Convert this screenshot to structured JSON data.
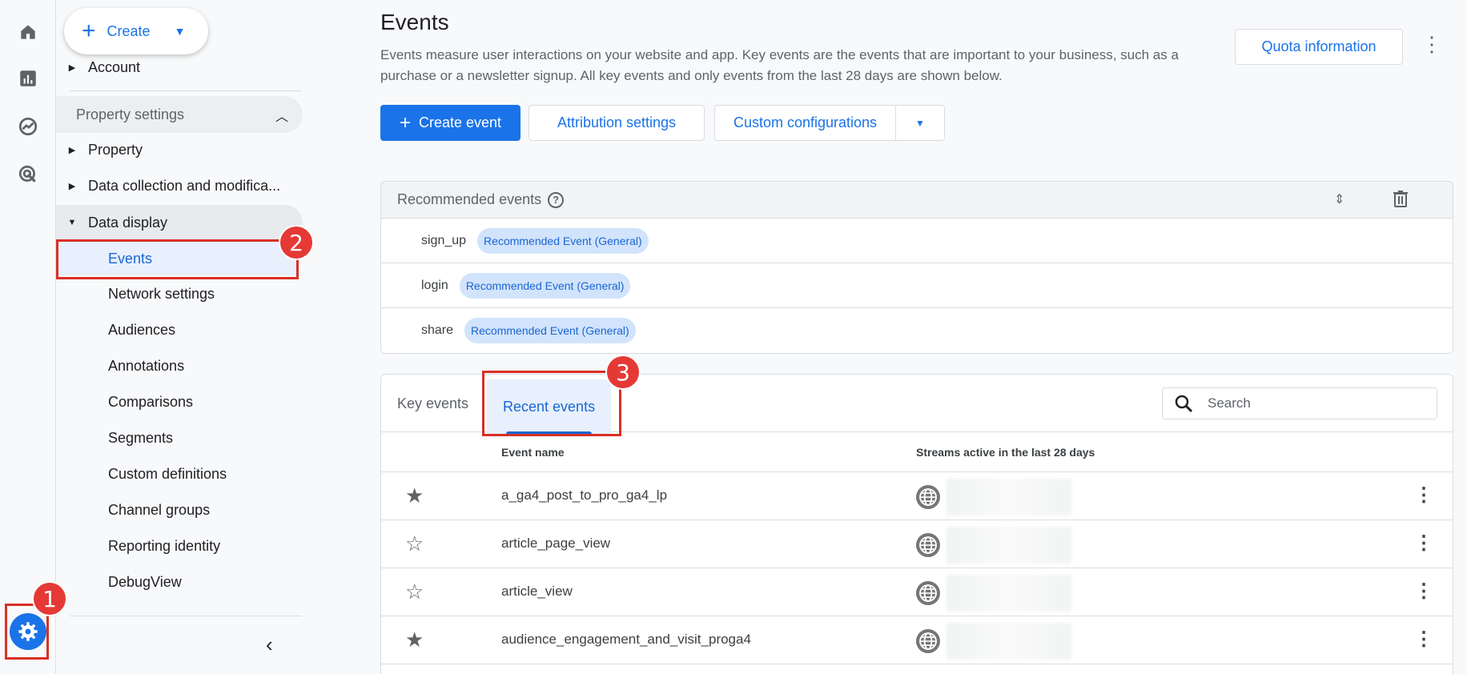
{
  "rail": {
    "icons": [
      "home-icon",
      "reports-icon",
      "explore-icon",
      "advertising-icon"
    ],
    "settings_icon": "gear-icon"
  },
  "annotations": {
    "badge1": "1",
    "badge2": "2",
    "badge3": "3",
    "color": "#d93025"
  },
  "nav": {
    "create_label": "Create",
    "account_label": "Account",
    "section_label": "Property settings",
    "items": {
      "property": "Property",
      "data_collection": "Data collection and modifica...",
      "data_display": "Data display"
    },
    "sub_items": [
      "Events",
      "Network settings",
      "Audiences",
      "Annotations",
      "Comparisons",
      "Segments",
      "Custom definitions",
      "Channel groups",
      "Reporting identity",
      "DebugView"
    ]
  },
  "main": {
    "title": "Events",
    "description": "Events measure user interactions on your website and app. Key events are the events that are important to your business, such as a purchase or a newsletter signup. All key events and only events from the last 28 days are shown below.",
    "quota_label": "Quota information",
    "create_event_label": "Create event",
    "attribution_label": "Attribution settings",
    "custom_config_label": "Custom configurations"
  },
  "recommended": {
    "title": "Recommended events",
    "rows": [
      {
        "event": "sign_up",
        "chip": "Recommended Event (General)"
      },
      {
        "event": "login",
        "chip": "Recommended Event (General)"
      },
      {
        "event": "share",
        "chip": "Recommended Event (General)"
      }
    ]
  },
  "events_table": {
    "tabs": [
      "Key events",
      "Recent events"
    ],
    "active_tab": "Recent events",
    "search_placeholder": "Search",
    "columns": [
      "Event name",
      "Streams active in the last 28 days"
    ],
    "rows": [
      {
        "name": "a_ga4_post_to_pro_ga4_lp",
        "key_event": true
      },
      {
        "name": "article_page_view",
        "key_event": false
      },
      {
        "name": "article_view",
        "key_event": false
      },
      {
        "name": "audience_engagement_and_visit_proga4",
        "key_event": true
      }
    ]
  },
  "colors": {
    "brand_blue": "#1a73e8",
    "chip_bg": "#d2e3fc",
    "active_bg": "#e8f0fe"
  }
}
